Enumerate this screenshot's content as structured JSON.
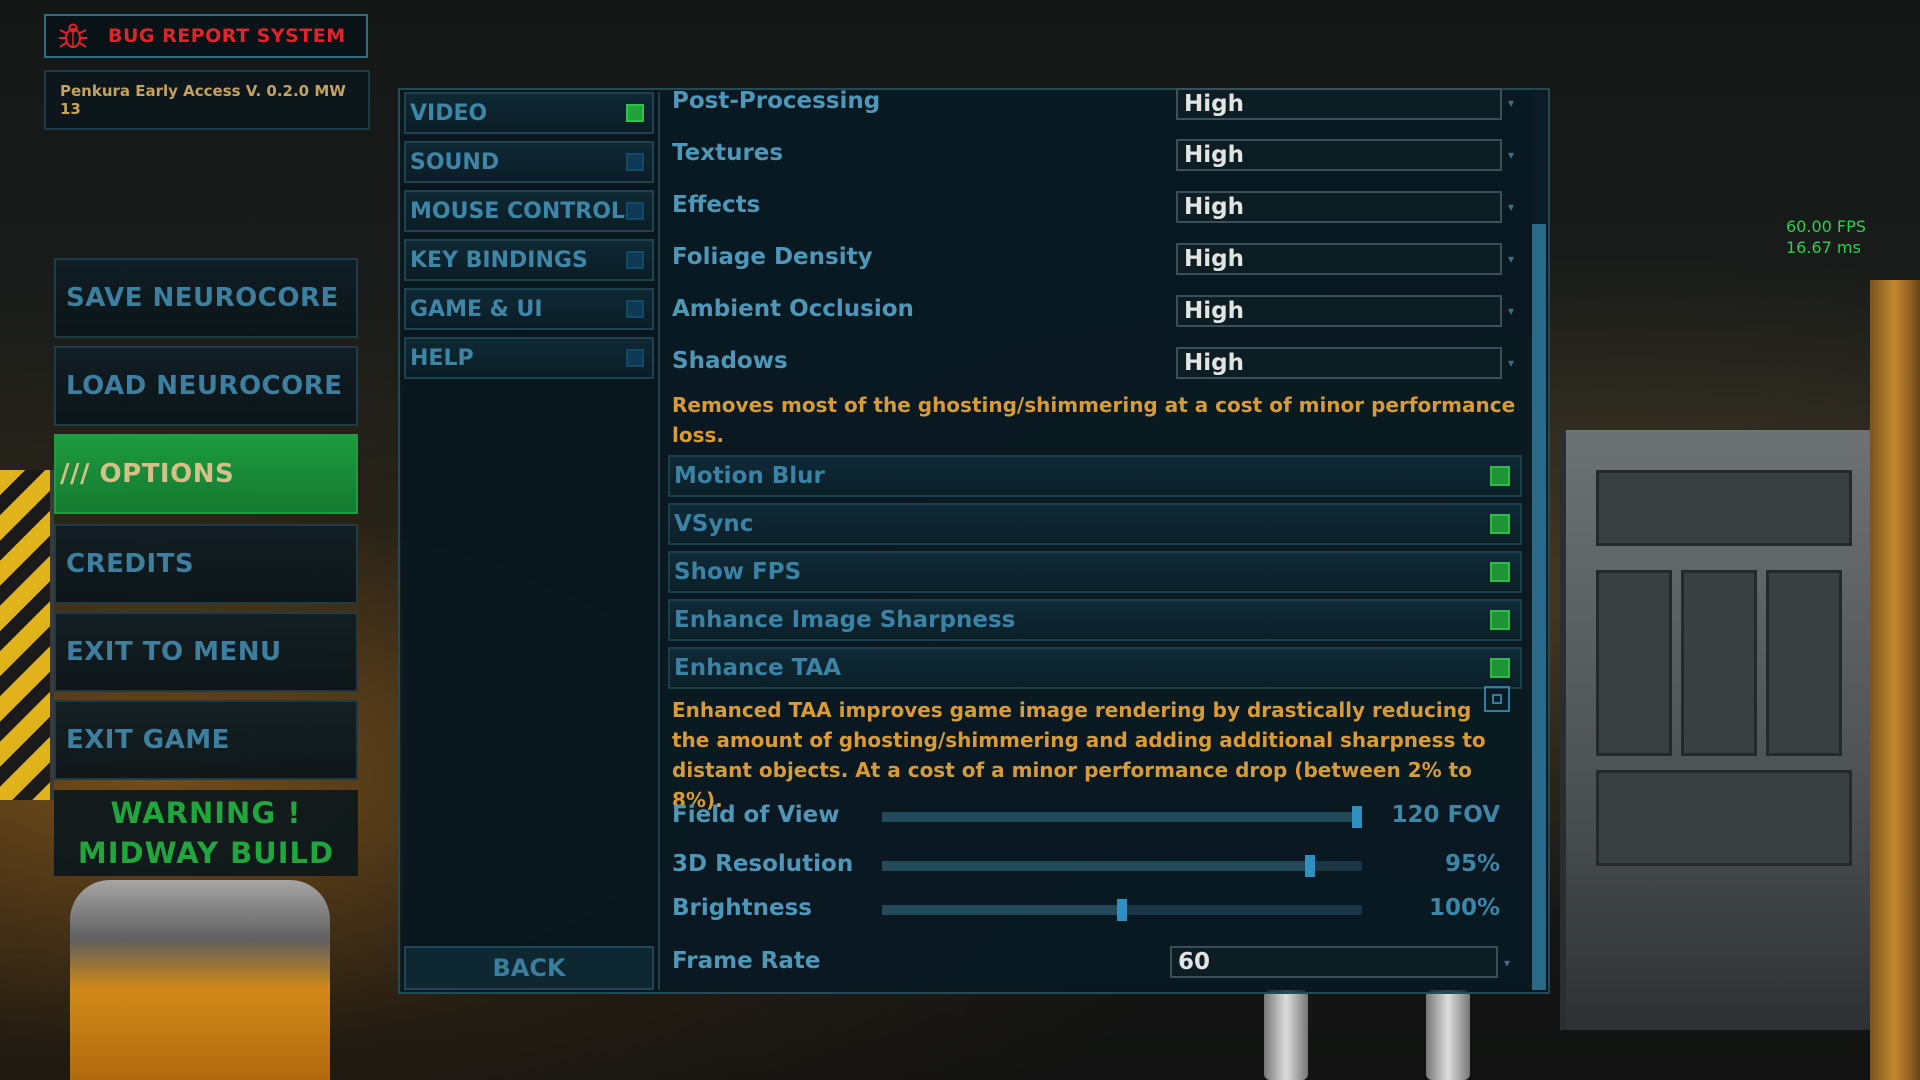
{
  "bug_report": {
    "label": "BUG REPORT SYSTEM",
    "icon": "bug-icon",
    "color": "#e0242a"
  },
  "version": "Penkura Early Access V. 0.2.0 MW 13",
  "main_menu": [
    {
      "label": "SAVE NEUROCORE",
      "active": false
    },
    {
      "label": "LOAD NEUROCORE",
      "active": false
    },
    {
      "label": "/// OPTIONS",
      "active": true
    },
    {
      "label": "CREDITS",
      "active": false
    },
    {
      "label": "EXIT TO MENU",
      "active": false
    },
    {
      "label": "EXIT GAME",
      "active": false
    }
  ],
  "warning": {
    "line1": "WARNING !",
    "line2": "MIDWAY BUILD"
  },
  "categories": [
    {
      "label": "VIDEO",
      "selected": true
    },
    {
      "label": "SOUND",
      "selected": false
    },
    {
      "label": "MOUSE CONTROL",
      "selected": false
    },
    {
      "label": "KEY BINDINGS",
      "selected": false
    },
    {
      "label": "GAME & UI",
      "selected": false
    },
    {
      "label": "HELP",
      "selected": false
    }
  ],
  "back_label": "BACK",
  "dropdown_settings": [
    {
      "label": "Post-Processing",
      "value": "High"
    },
    {
      "label": "Textures",
      "value": "High"
    },
    {
      "label": "Effects",
      "value": "High"
    },
    {
      "label": "Foliage Density",
      "value": "High"
    },
    {
      "label": "Ambient Occlusion",
      "value": "High"
    },
    {
      "label": "Shadows",
      "value": "High"
    }
  ],
  "desc_ghosting": "Removes most of the ghosting/shimmering at a cost of minor performance loss.",
  "toggles": [
    {
      "label": "Motion Blur",
      "checked": true
    },
    {
      "label": "VSync",
      "checked": true
    },
    {
      "label": "Show FPS",
      "checked": true
    },
    {
      "label": "Enhance Image Sharpness",
      "checked": true
    },
    {
      "label": "Enhance TAA",
      "checked": true
    }
  ],
  "desc_taa": "Enhanced TAA improves game image rendering by drastically reducing the amount of ghosting/shimmering and adding additional sharpness to distant objects. At a cost of a minor performance drop (between 2% to 8%).",
  "sliders": [
    {
      "label": "Field of View",
      "display": "120 FOV",
      "fraction": 1.0
    },
    {
      "label": "3D Resolution",
      "display": "95%",
      "fraction": 0.9
    },
    {
      "label": "Brightness",
      "display": "100%",
      "fraction": 0.5
    }
  ],
  "frame_rate": {
    "label": "Frame Rate",
    "value": "60"
  },
  "fps_overlay": {
    "fps": "60.00 FPS",
    "ms": "16.67 ms"
  },
  "colors": {
    "accent_green": "#1e9a40",
    "menu_text": "#3e7fa0",
    "desc_text": "#d89b36",
    "warning": "#21a63e"
  }
}
